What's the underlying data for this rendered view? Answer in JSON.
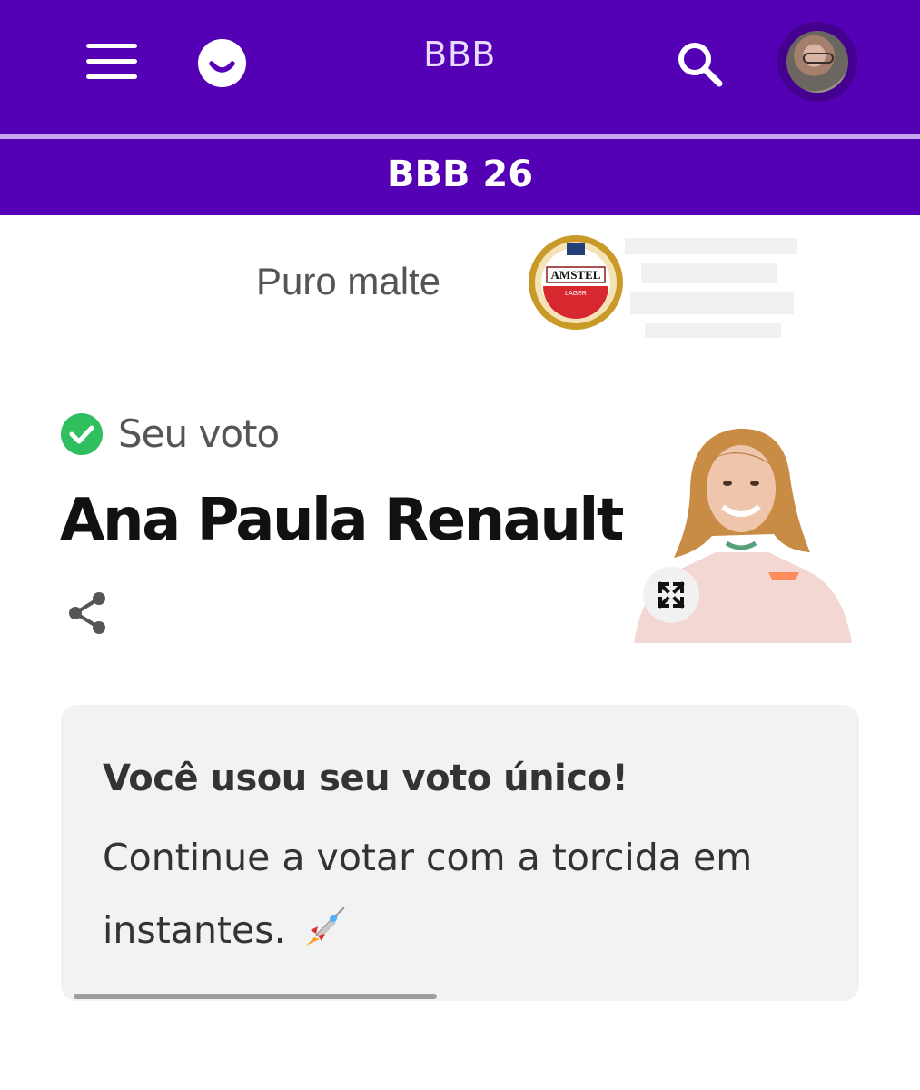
{
  "header": {
    "title": "BBB",
    "menu_icon": "hamburger-menu-icon",
    "logo_icon": "smile-logo-icon",
    "search_icon": "search-icon",
    "avatar_icon": "user-avatar",
    "bg_color": "#5400b5"
  },
  "subheader": {
    "title": "BBB 26"
  },
  "sponsor": {
    "text": "Puro malte",
    "logo_text_top": "AMSTEL",
    "logo_text_bottom": "LAGER"
  },
  "vote": {
    "status_label": "Seu voto",
    "status_icon": "check-circle-icon",
    "status_color": "#2fbf5f",
    "candidate_name": "Ana Paula Renault",
    "share_icon": "share-icon",
    "expand_icon": "expand-icon"
  },
  "notice": {
    "title": "Você usou seu voto único!",
    "message": "Continue a votar com a torcida em instantes.",
    "emoji_icon": "rocket-icon",
    "progress": 0.47
  }
}
